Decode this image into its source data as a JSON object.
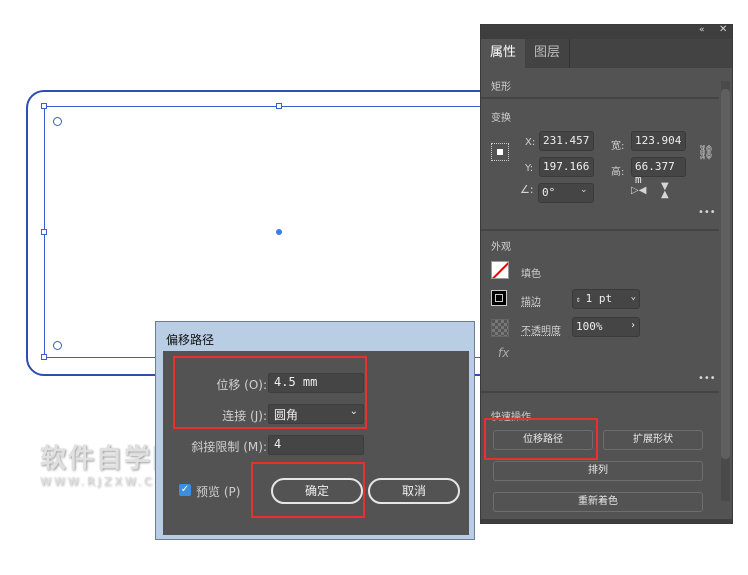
{
  "watermark": {
    "title": "软件自学网",
    "url": "WWW.RJZXW.COM"
  },
  "panel": {
    "tabs": [
      "属性",
      "图层"
    ],
    "object_type": "矩形",
    "transform": {
      "title": "变换",
      "x_label": "X:",
      "x": "231.457",
      "y_label": "Y:",
      "y": "197.166",
      "w_label": "宽:",
      "w": "123.904",
      "h_label": "高:",
      "h": "66.377 m",
      "angle": "0°"
    },
    "appearance": {
      "title": "外观",
      "fill": "填色",
      "stroke": "描边",
      "stroke_value": "1 pt",
      "opacity": "不透明度",
      "opacity_value": "100%",
      "fx": "fx"
    },
    "quick": {
      "title": "快速操作",
      "offset_path": "位移路径",
      "expand_shape": "扩展形状",
      "arrange": "排列",
      "recolor": "重新着色"
    }
  },
  "dialog": {
    "title": "偏移路径",
    "offset_label": "位移 (O):",
    "offset_value": "4.5 mm",
    "join_label": "连接 (J):",
    "join_value": "圆角",
    "miter_label": "斜接限制 (M):",
    "miter_value": "4",
    "preview_label": "预览 (P)",
    "preview_checked": true,
    "ok": "确定",
    "cancel": "取消"
  },
  "colors": {
    "selection": "#3a5fc8",
    "highlight": "#e8302f"
  }
}
